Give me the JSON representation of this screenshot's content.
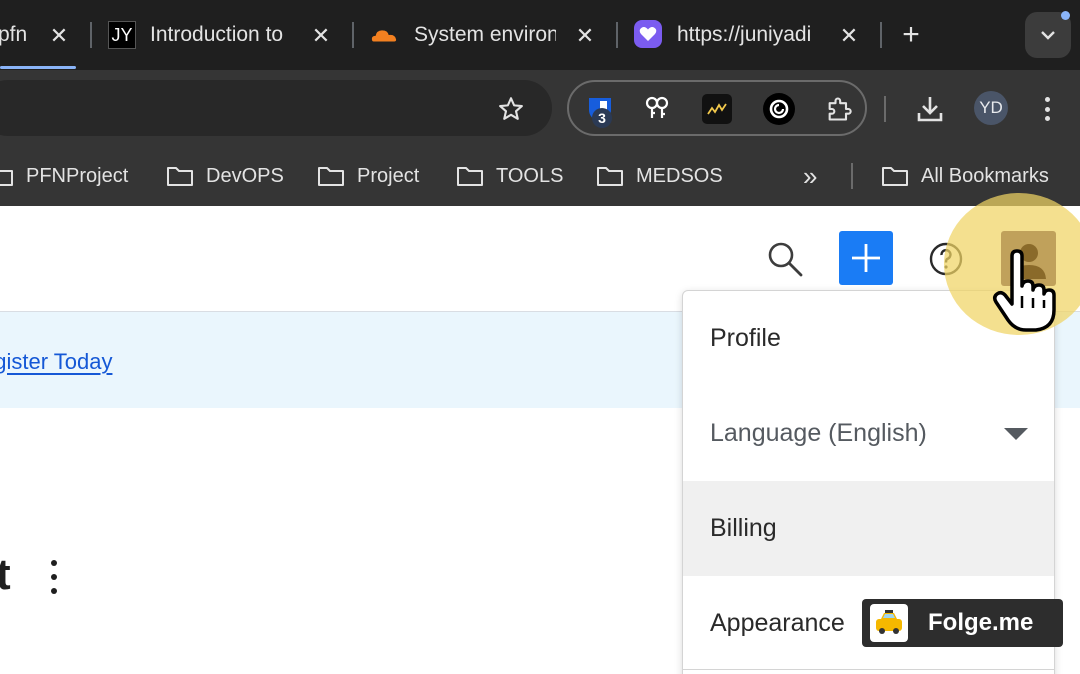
{
  "browser": {
    "tabs": [
      {
        "title": "pfn",
        "close": "✕",
        "active": true
      },
      {
        "title": "Introduction to",
        "favicon": "JY",
        "close": "✕"
      },
      {
        "title": "System environ",
        "favicon": "cloudflare-icon",
        "close": "✕"
      },
      {
        "title": "https://juniyadi",
        "favicon": "heart-chat-icon",
        "close": "✕"
      }
    ],
    "new_tab": "+",
    "tab_search": "chevron-down-icon",
    "extensions": {
      "badge": "3",
      "icons": [
        "bitwarden-icon",
        "keys-icon",
        "chart-icon",
        "copilot-icon",
        "puzzle-icon"
      ]
    },
    "download": "download-icon",
    "profile": "YD",
    "menu": "more-vert-icon"
  },
  "bookmarks": {
    "items": [
      "PFNProject",
      "DevOPS",
      "Project",
      "TOOLS",
      "MEDSOS"
    ],
    "overflow": "»",
    "all": "All Bookmarks"
  },
  "page": {
    "banner_link": "egister Today",
    "heading_fragment": "t"
  },
  "menu": {
    "items": [
      {
        "label": "Profile"
      },
      {
        "label": "Language (English)"
      },
      {
        "label": "Billing"
      },
      {
        "label": "Appearance"
      }
    ]
  },
  "watermark": {
    "text": "Folge.me"
  },
  "colors": {
    "accent": "#1a7cf5",
    "highlight": "#f0d464",
    "avatar": "#c0a15b",
    "link": "#1558d6"
  }
}
